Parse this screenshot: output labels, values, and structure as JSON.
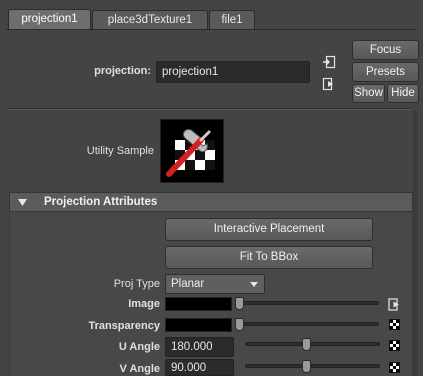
{
  "tabs": [
    {
      "label": "projection1",
      "active": true
    },
    {
      "label": "place3dTexture1",
      "active": false
    },
    {
      "label": "file1",
      "active": false
    }
  ],
  "node": {
    "name_label": "projection:",
    "name_value": "projection1"
  },
  "buttons": {
    "focus": "Focus",
    "presets": "Presets",
    "show": "Show",
    "hide": "Hide"
  },
  "sample": {
    "label": "Utility Sample"
  },
  "section": {
    "title": "Projection Attributes"
  },
  "actions": {
    "interactive_placement": "Interactive Placement",
    "fit_to_bbox": "Fit To BBox"
  },
  "attributes": {
    "proj_type": {
      "label": "Proj Type",
      "value": "Planar"
    },
    "image": {
      "label": "Image",
      "color": "#000000",
      "level": 0
    },
    "transparency": {
      "label": "Transparency",
      "color": "#000000",
      "level": 0
    },
    "u_angle": {
      "label": "U Angle",
      "value": "180.000",
      "level": 0.5
    },
    "v_angle": {
      "label": "V Angle",
      "value": "90.000",
      "level": 0.5
    }
  },
  "colors": {
    "background": "#444444",
    "field": "#2b2b2b",
    "button": "#5d5d5d"
  }
}
